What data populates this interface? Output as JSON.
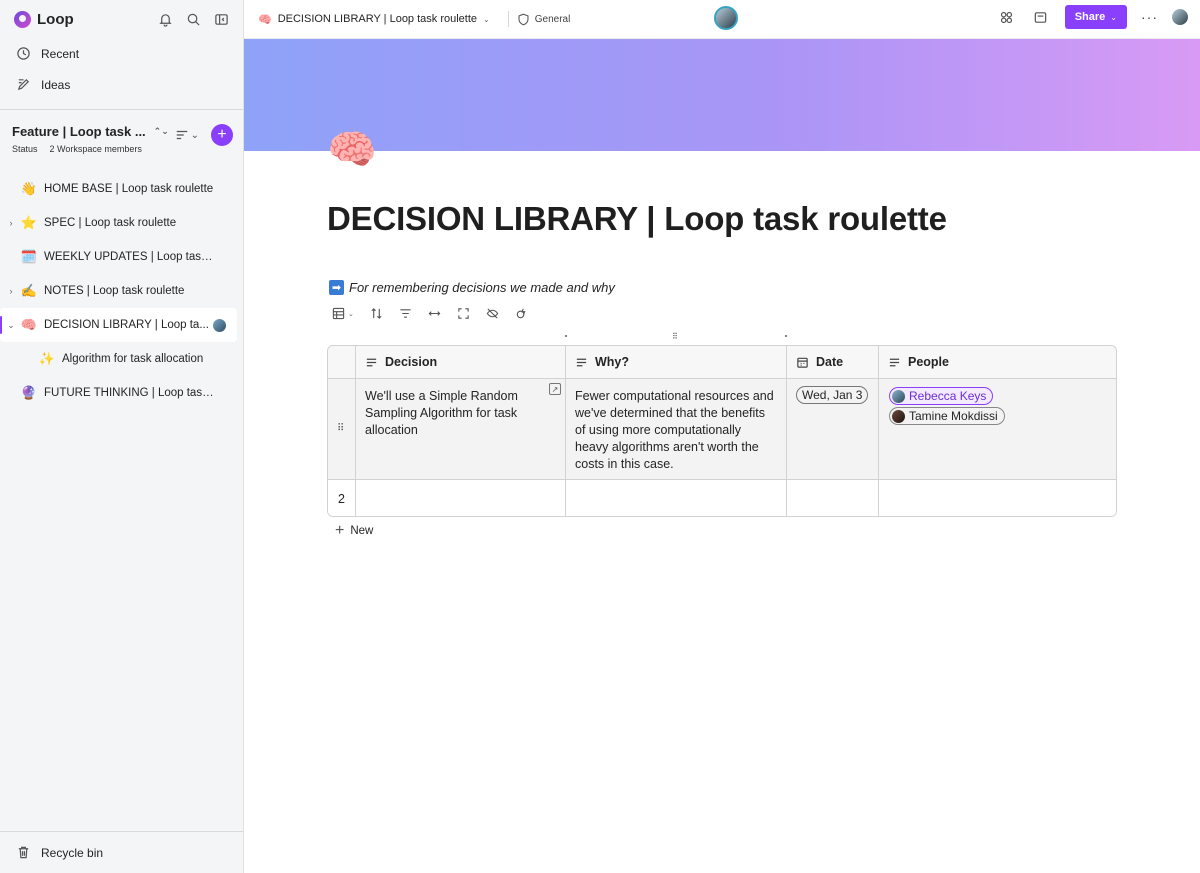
{
  "app": {
    "name": "Loop"
  },
  "sidebar": {
    "nav": [
      {
        "label": "Recent",
        "icon": "clock-icon"
      },
      {
        "label": "Ideas",
        "icon": "ideas-icon"
      }
    ],
    "workspace": {
      "title": "Feature | Loop task ...",
      "status_label": "Status",
      "members_label": "2 Workspace members"
    },
    "pages": [
      {
        "emoji": "👋",
        "label": "HOME BASE | Loop task roulette",
        "twisty": ""
      },
      {
        "emoji": "⭐",
        "label": "SPEC | Loop task roulette",
        "twisty": "›"
      },
      {
        "emoji": "🗓️",
        "label": "WEEKLY UPDATES | Loop task rou...",
        "twisty": ""
      },
      {
        "emoji": "✍️",
        "label": "NOTES | Loop task roulette",
        "twisty": "›"
      },
      {
        "emoji": "🧠",
        "label": "DECISION LIBRARY | Loop ta...",
        "twisty": "⌄"
      },
      {
        "emoji": "✨",
        "label": "Algorithm for task allocation",
        "twisty": ""
      },
      {
        "emoji": "🔮",
        "label": "FUTURE THINKING | Loop task ro...",
        "twisty": ""
      }
    ],
    "recycle_bin": "Recycle bin"
  },
  "topbar": {
    "breadcrumb_emoji": "🧠",
    "breadcrumb": "DECISION LIBRARY | Loop task roulette",
    "sensitivity": "General",
    "share": "Share"
  },
  "page": {
    "icon": "🧠",
    "title": "DECISION LIBRARY | Loop task roulette",
    "subtitle_arrow": "➡",
    "subtitle": "For remembering decisions we made and why"
  },
  "table": {
    "columns": [
      {
        "label": "Decision",
        "icon": "text-icon"
      },
      {
        "label": "Why?",
        "icon": "text-icon"
      },
      {
        "label": "Date",
        "icon": "calendar-icon"
      },
      {
        "label": "People",
        "icon": "text-icon"
      }
    ],
    "rows": [
      {
        "decision": "We'll use a Simple Random Sampling Algorithm for task allocation",
        "why": "Fewer computational resources and we've determined that the benefits of using more computationally heavy algorithms aren't worth the costs in this case.",
        "date": "Wed, Jan 3",
        "people": [
          "Rebecca Keys",
          "Tamine Mokdissi"
        ]
      },
      {
        "number": "2",
        "decision": "",
        "why": "",
        "date": "",
        "people": []
      }
    ],
    "new_label": "New"
  },
  "colors": {
    "accent": "#8a3ffc",
    "banner_start": "#8ea2f8",
    "banner_end": "#d89af5"
  }
}
